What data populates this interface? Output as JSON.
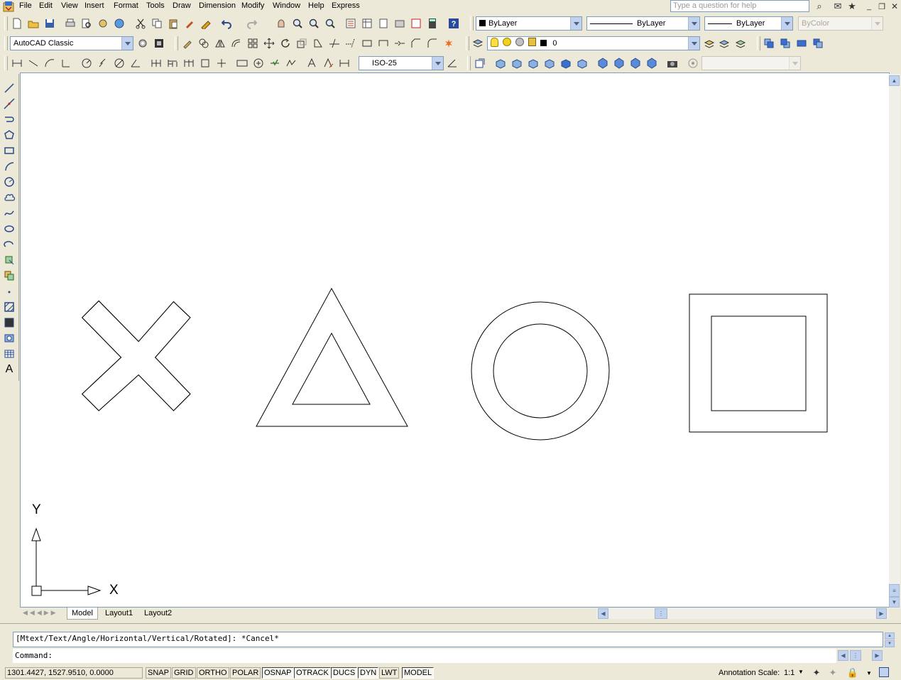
{
  "menu": {
    "items": [
      "File",
      "Edit",
      "View",
      "Insert",
      "Format",
      "Tools",
      "Draw",
      "Dimension",
      "Modify",
      "Window",
      "Help",
      "Express"
    ],
    "help_placeholder": "Type a question for help"
  },
  "properties": {
    "color": "ByLayer",
    "linetype": "ByLayer",
    "lineweight": "ByLayer",
    "plotstyle": "ByColor"
  },
  "workspace": {
    "current": "AutoCAD Classic"
  },
  "layer": {
    "current": "0"
  },
  "dimstyle": {
    "current": "ISO-25"
  },
  "tabs": [
    "Model",
    "Layout1",
    "Layout2"
  ],
  "ucs": {
    "x_label": "X",
    "y_label": "Y"
  },
  "command": {
    "history": "[Mtext/Text/Angle/Horizontal/Vertical/Rotated]: *Cancel*",
    "prompt": "Command:"
  },
  "status": {
    "coordinates": "1301.4427, 1527.9510, 0.0000",
    "toggles": [
      {
        "label": "SNAP",
        "on": false
      },
      {
        "label": "GRID",
        "on": false
      },
      {
        "label": "ORTHO",
        "on": false
      },
      {
        "label": "POLAR",
        "on": false
      },
      {
        "label": "OSNAP",
        "on": true
      },
      {
        "label": "OTRACK",
        "on": true
      },
      {
        "label": "DUCS",
        "on": true
      },
      {
        "label": "DYN",
        "on": true
      },
      {
        "label": "LWT",
        "on": false
      },
      {
        "label": "MODEL",
        "on": true
      }
    ],
    "annotation_scale_label": "Annotation Scale:",
    "annotation_scale_value": "1:1"
  },
  "colors": {
    "accent": "#316ac5",
    "chrome": "#ece9d8",
    "border": "#7f9db9"
  }
}
